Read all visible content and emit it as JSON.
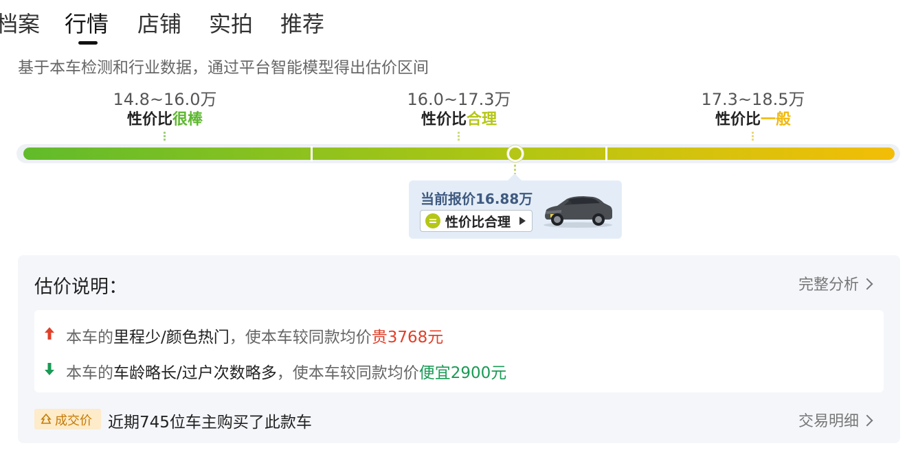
{
  "tabs": [
    {
      "label": "档案"
    },
    {
      "label": "行情",
      "active": true
    },
    {
      "label": "店铺"
    },
    {
      "label": "实拍"
    },
    {
      "label": "推荐"
    }
  ],
  "subtitle": "基于本车检测和行业数据，通过平台智能模型得出估价区间",
  "bands": [
    {
      "range": "14.8~16.0万",
      "label_prefix": "性价比",
      "label_value": "很棒",
      "color": "#5db82e"
    },
    {
      "range": "16.0~17.3万",
      "label_prefix": "性价比",
      "label_value": "合理",
      "color": "#b5c617"
    },
    {
      "range": "17.3~18.5万",
      "label_prefix": "性价比",
      "label_value": "一般",
      "color": "#f0b90b"
    }
  ],
  "current": {
    "price_text": "当前报价16.88万",
    "value_rating": "性价比合理",
    "price_wan": 16.88
  },
  "explanation": {
    "title": "估价说明：",
    "full_analysis_link": "完整分析",
    "reasons": [
      {
        "direction": "up",
        "prefix": "本车的",
        "highlight": "里程少/颜色热门",
        "middle": "，使本车较同款均价",
        "delta": "贵3768元",
        "icon": "arrow-up-icon"
      },
      {
        "direction": "down",
        "prefix": "本车的",
        "highlight": "车龄略长/过户次数略多",
        "middle": "，使本车较同款均价",
        "delta": "便宜2900元",
        "icon": "arrow-down-icon"
      }
    ],
    "deal_badge": "成交价",
    "deal_text": "近期745位车主购买了此款车",
    "trade_detail_link": "交易明细"
  },
  "colors": {
    "up": "#e0402a",
    "down": "#1a9a55",
    "accent": "#b5c617"
  }
}
